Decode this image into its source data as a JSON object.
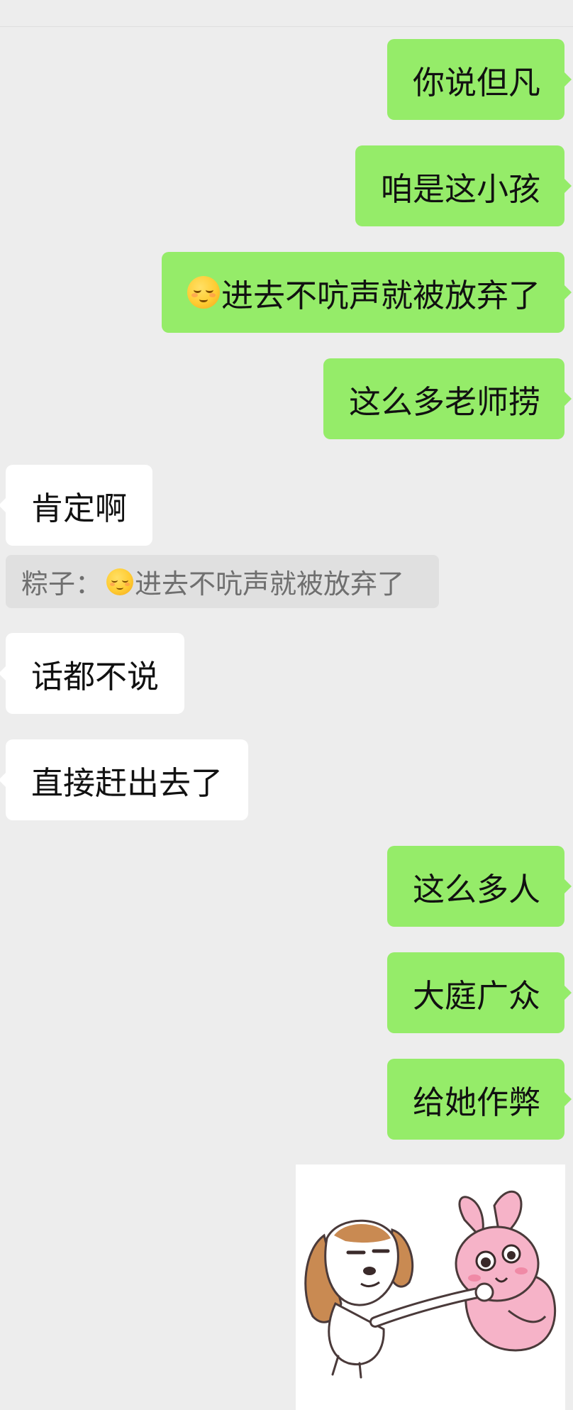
{
  "messages": [
    {
      "text": "你说但凡"
    },
    {
      "text": "咱是这小孩"
    },
    {
      "text": "进去不吭声就被放弃了",
      "emoji": "relieved-face-icon"
    },
    {
      "text": "这么多老师捞"
    },
    {
      "text": "肯定啊"
    },
    {
      "text": "话都不说"
    },
    {
      "text": "直接赶出去了"
    },
    {
      "text": "这么多人"
    },
    {
      "text": "大庭广众"
    },
    {
      "text": "给她作弊"
    }
  ],
  "quote": {
    "sender": "粽子：",
    "text": "进去不吭声就被放弃了",
    "emoji": "relieved-face-icon"
  },
  "colors": {
    "background": "#ededed",
    "self_bubble": "#95ec69",
    "other_bubble": "#ffffff",
    "quote_bg": "#e0e0e0"
  },
  "sticker": {
    "name": "dog-pushing-bunny-sticker"
  }
}
